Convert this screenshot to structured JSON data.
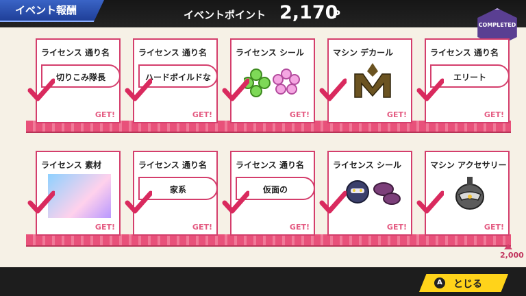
{
  "header": {
    "tab_title": "イベント報酬",
    "points_label": "イベントポイント",
    "points_value": "2,170",
    "points_unit": "P",
    "badge": "COMPLETED"
  },
  "footer": {
    "button_key": "A",
    "button_label": "とじる"
  },
  "progress": {
    "goal": "2,000"
  },
  "rows": [
    [
      {
        "category": "ライセンス 通り名",
        "value": "切りこみ隊長",
        "get": "GET!"
      },
      {
        "category": "ライセンス 通り名",
        "value": "ハードボイルドな",
        "get": "GET!"
      },
      {
        "category": "ライセンス シール",
        "icon": "flower-stickers-icon",
        "get": "GET!"
      },
      {
        "category": "マシン デカール",
        "icon": "m-decal-icon",
        "get": "GET!"
      },
      {
        "category": "ライセンス 通り名",
        "value": "エリート",
        "get": "GET!"
      }
    ],
    [
      {
        "category": "ライセンス 素材",
        "icon": "landscape-photo-icon",
        "get": "GET!"
      },
      {
        "category": "ライセンス 通り名",
        "value": "家系",
        "get": "GET!"
      },
      {
        "category": "ライセンス 通り名",
        "value": "仮面の",
        "get": "GET!"
      },
      {
        "category": "ライセンス シール",
        "icon": "knight-sticker-icon",
        "get": "GET!"
      },
      {
        "category": "マシン アクセサリー",
        "icon": "helmet-icon",
        "get": "GET!"
      }
    ]
  ],
  "colors": {
    "accent": "#d43e6c",
    "header_blue": "#2a4fb0",
    "button_yellow": "#ffd31a"
  }
}
